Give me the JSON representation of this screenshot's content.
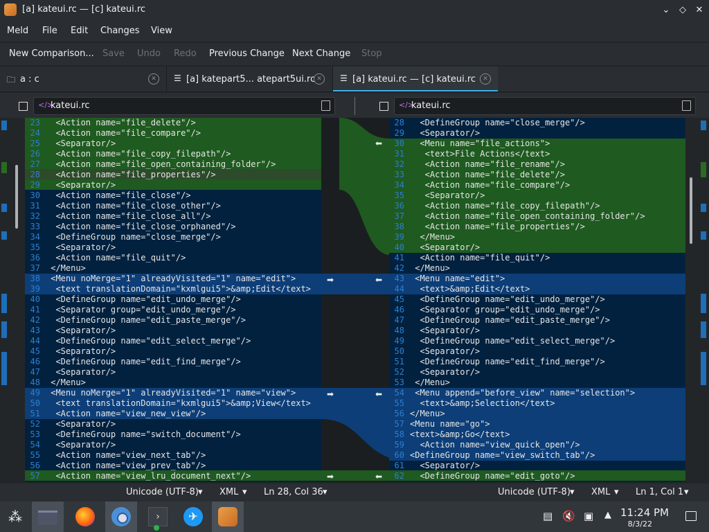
{
  "window": {
    "title": "[a] kateui.rc — [c] kateui.rc"
  },
  "menubar": {
    "items": [
      "Meld",
      "File",
      "Edit",
      "Changes",
      "View"
    ]
  },
  "toolbar": {
    "new_comparison": "New Comparison...",
    "save": "Save",
    "undo": "Undo",
    "redo": "Redo",
    "previous_change": "Previous Change",
    "next_change": "Next Change",
    "stop": "Stop"
  },
  "tabs": [
    {
      "label": "a : c"
    },
    {
      "label": "[a] katepart5... atepart5ui.rc"
    },
    {
      "label": "[a] kateui.rc — [c] kateui.rc"
    }
  ],
  "files": {
    "left": "kateui.rc",
    "right": "kateui.rc"
  },
  "left_lines": [
    {
      "n": "23",
      "code": "  <Action name=\"file_delete\"/>"
    },
    {
      "n": "24",
      "code": "  <Action name=\"file_compare\"/>"
    },
    {
      "n": "25",
      "code": "  <Separator/>"
    },
    {
      "n": "26",
      "code": "  <Action name=\"file_copy_filepath\"/>"
    },
    {
      "n": "27",
      "code": "  <Action name=\"file_open_containing_folder\"/>"
    },
    {
      "n": "28",
      "code": "  <Action name=\"file_properties\"/>"
    },
    {
      "n": "29",
      "code": "  <Separator/>"
    },
    {
      "n": "30",
      "code": "  <Action name=\"file_close\"/>"
    },
    {
      "n": "31",
      "code": "  <Action name=\"file_close_other\"/>"
    },
    {
      "n": "32",
      "code": "  <Action name=\"file_close_all\"/>"
    },
    {
      "n": "33",
      "code": "  <Action name=\"file_close_orphaned\"/>"
    },
    {
      "n": "34",
      "code": "  <DefineGroup name=\"close_merge\"/>"
    },
    {
      "n": "35",
      "code": "  <Separator/>"
    },
    {
      "n": "36",
      "code": "  <Action name=\"file_quit\"/>"
    },
    {
      "n": "37",
      "code": " </Menu>"
    },
    {
      "n": "38",
      "code": " <Menu noMerge=\"1\" alreadyVisited=\"1\" name=\"edit\">"
    },
    {
      "n": "39",
      "code": "  <text translationDomain=\"kxmlgui5\">&amp;Edit</text>"
    },
    {
      "n": "40",
      "code": "  <DefineGroup name=\"edit_undo_merge\"/>"
    },
    {
      "n": "41",
      "code": "  <Separator group=\"edit_undo_merge\"/>"
    },
    {
      "n": "42",
      "code": "  <DefineGroup name=\"edit_paste_merge\"/>"
    },
    {
      "n": "43",
      "code": "  <Separator/>"
    },
    {
      "n": "44",
      "code": "  <DefineGroup name=\"edit_select_merge\"/>"
    },
    {
      "n": "45",
      "code": "  <Separator/>"
    },
    {
      "n": "46",
      "code": "  <DefineGroup name=\"edit_find_merge\"/>"
    },
    {
      "n": "47",
      "code": "  <Separator/>"
    },
    {
      "n": "48",
      "code": " </Menu>"
    },
    {
      "n": "49",
      "code": " <Menu noMerge=\"1\" alreadyVisited=\"1\" name=\"view\">"
    },
    {
      "n": "50",
      "code": "  <text translationDomain=\"kxmlgui5\">&amp;View</text>"
    },
    {
      "n": "51",
      "code": "  <Action name=\"view_new_view\"/>"
    },
    {
      "n": "52",
      "code": "  <Separator/>"
    },
    {
      "n": "53",
      "code": "  <DefineGroup name=\"switch_document\"/>"
    },
    {
      "n": "54",
      "code": "  <Separator/>"
    },
    {
      "n": "55",
      "code": "  <Action name=\"view_next_tab\"/>"
    },
    {
      "n": "56",
      "code": "  <Action name=\"view_prev_tab\"/>"
    },
    {
      "n": "57",
      "code": "  <Action name=\"view_lru_document_next\"/>"
    }
  ],
  "right_lines": [
    {
      "n": "28",
      "code": "  <DefineGroup name=\"close_merge\"/>"
    },
    {
      "n": "29",
      "code": "  <Separator/>"
    },
    {
      "n": "30",
      "code": "  <Menu name=\"file_actions\">"
    },
    {
      "n": "31",
      "code": "   <text>File Actions</text>"
    },
    {
      "n": "32",
      "code": "   <Action name=\"file_rename\"/>"
    },
    {
      "n": "33",
      "code": "   <Action name=\"file_delete\"/>"
    },
    {
      "n": "34",
      "code": "   <Action name=\"file_compare\"/>"
    },
    {
      "n": "35",
      "code": "   <Separator/>"
    },
    {
      "n": "36",
      "code": "   <Action name=\"file_copy_filepath\"/>"
    },
    {
      "n": "37",
      "code": "   <Action name=\"file_open_containing_folder\"/>"
    },
    {
      "n": "38",
      "code": "   <Action name=\"file_properties\"/>"
    },
    {
      "n": "39",
      "code": "  </Menu>"
    },
    {
      "n": "40",
      "code": "  <Separator/>"
    },
    {
      "n": "41",
      "code": "  <Action name=\"file_quit\"/>"
    },
    {
      "n": "42",
      "code": " </Menu>"
    },
    {
      "n": "43",
      "code": " <Menu name=\"edit\">"
    },
    {
      "n": "44",
      "code": "  <text>&amp;Edit</text>"
    },
    {
      "n": "45",
      "code": "  <DefineGroup name=\"edit_undo_merge\"/>"
    },
    {
      "n": "46",
      "code": "  <Separator group=\"edit_undo_merge\"/>"
    },
    {
      "n": "47",
      "code": "  <DefineGroup name=\"edit_paste_merge\"/>"
    },
    {
      "n": "48",
      "code": "  <Separator/>"
    },
    {
      "n": "49",
      "code": "  <DefineGroup name=\"edit_select_merge\"/>"
    },
    {
      "n": "50",
      "code": "  <Separator/>"
    },
    {
      "n": "51",
      "code": "  <DefineGroup name=\"edit_find_merge\"/>"
    },
    {
      "n": "52",
      "code": "  <Separator/>"
    },
    {
      "n": "53",
      "code": " </Menu>"
    },
    {
      "n": "54",
      "code": " <Menu append=\"before_view\" name=\"selection\">"
    },
    {
      "n": "55",
      "code": "  <text>&amp;Selection</text>"
    },
    {
      "n": "56",
      "code": "</Menu>"
    },
    {
      "n": "57",
      "code": "<Menu name=\"go\">"
    },
    {
      "n": "58",
      "code": "<text>&amp;Go</text>"
    },
    {
      "n": "59",
      "code": "  <Action name=\"view_quick_open\"/>"
    },
    {
      "n": "60",
      "code": "<DefineGroup name=\"view_switch_tab\"/>"
    },
    {
      "n": "61",
      "code": "  <Separator/>"
    },
    {
      "n": "62",
      "code": "  <DefineGroup name=\"edit_goto\"/>"
    }
  ],
  "status_left": {
    "encoding": "Unicode (UTF-8)",
    "language": "XML",
    "position": "Ln 28, Col 36"
  },
  "status_right": {
    "encoding": "Unicode (UTF-8)",
    "language": "XML",
    "position": "Ln 1, Col 1"
  },
  "taskbar": {
    "time": "11:24 PM",
    "date": "8/3/22"
  },
  "colors": {
    "changed": "#1f5a20",
    "modified": "#0d3e78",
    "editor_bg": "#02213f",
    "line_number": "#2d7fcf"
  }
}
